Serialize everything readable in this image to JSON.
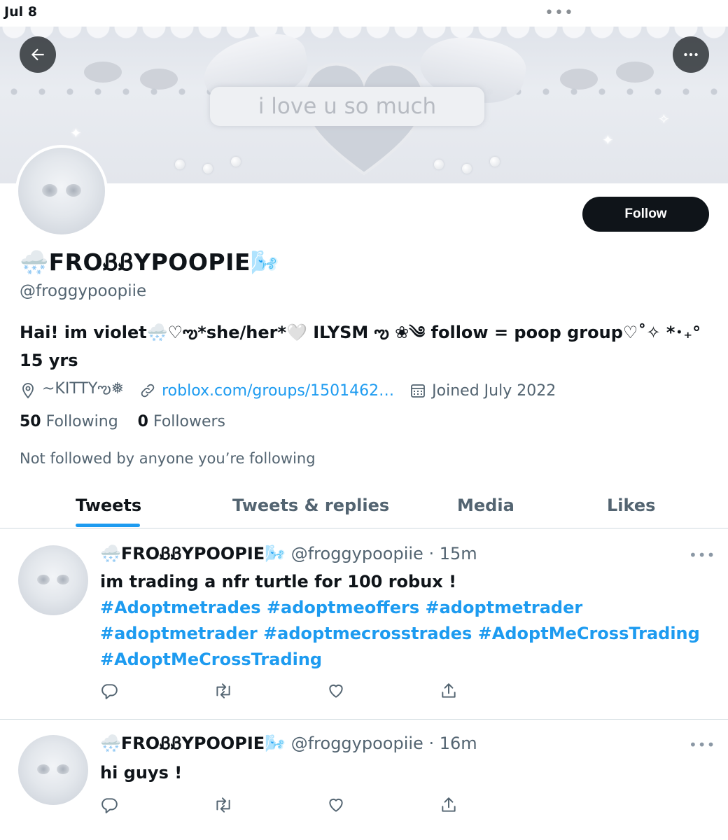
{
  "status_bar": {
    "time": "Jul 8",
    "dots": "•••"
  },
  "banner": {
    "caption": "i love u so much"
  },
  "profile": {
    "display_name": "🌨️FROᏰᏰYPOOPIE🌬️",
    "handle": "@froggypoopiie",
    "bio_line1": "Hai! im violet🌨️♡ఌ*she/her*🤍 ILYSM ఌ ❀༄ follow = poop group♡˚✧ *･₊°",
    "bio_line2": "15 yrs",
    "location": "~KITTYఌ❅",
    "website": "roblox.com/groups/1501462…",
    "joined": "Joined July 2022",
    "following_count": "50",
    "following_label": "Following",
    "followers_count": "0",
    "followers_label": "Followers",
    "not_followed": "Not followed by anyone you’re following",
    "follow_label": "Follow"
  },
  "tabs": [
    {
      "label": "Tweets",
      "active": true
    },
    {
      "label": "Tweets & replies",
      "active": false
    },
    {
      "label": "Media",
      "active": false
    },
    {
      "label": "Likes",
      "active": false
    }
  ],
  "tweets": [
    {
      "name": "🌨️FROᏰᏰYPOOPIE🌬️",
      "handle": "@froggypoopiie",
      "time": "· 15m",
      "text": "im trading a nfr turtle for 100 robux !",
      "hashtags_line1": "#Adoptmetrades #adoptmeoffers #adoptmetrader",
      "hashtags_line2": "#adoptmetrader #adoptmecrosstrades #AdoptMeCrossTrading",
      "hashtags_line3": "#AdoptMeCrossTrading",
      "more": "•••"
    },
    {
      "name": "🌨️FROᏰᏰYPOOPIE🌬️",
      "handle": "@froggypoopiie",
      "time": "· 16m",
      "text": "hi guys !",
      "more": "•••"
    }
  ],
  "colors": {
    "accent": "#1d9bf0",
    "text": "#0f1419",
    "muted": "#536471",
    "follow_bg": "#0f1419"
  },
  "icons": [
    "back-arrow-icon",
    "more-icon",
    "location-icon",
    "link-icon",
    "calendar-icon",
    "reply-icon",
    "retweet-icon",
    "like-icon",
    "share-icon"
  ]
}
